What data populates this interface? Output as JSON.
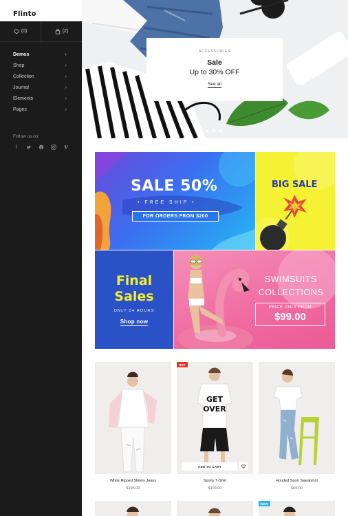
{
  "brand": {
    "logo": "Flinto"
  },
  "sidebar": {
    "wishlist_count": "(0)",
    "cart_count": "(2)",
    "nav": [
      {
        "label": "Demos"
      },
      {
        "label": "Shop"
      },
      {
        "label": "Collection"
      },
      {
        "label": "Journal"
      },
      {
        "label": "Elements"
      },
      {
        "label": "Pages"
      }
    ],
    "follow_label": "Follow us on:",
    "social_icons": [
      "facebook-icon",
      "twitter-icon",
      "pinterest-icon",
      "instagram-icon",
      "vimeo-icon"
    ]
  },
  "hero": {
    "eyebrow": "ACCESSORIES",
    "title": "Sale",
    "subtitle": "Up to 30% OFF",
    "link": "See all",
    "slides_total": 3,
    "active_slide": 1
  },
  "banners": {
    "sale": {
      "headline": "SALE 50%",
      "sub": "• FREE SHIP •",
      "pill": "FOR ORDERS FROM $200"
    },
    "big_sale": {
      "headline": "BIG SALE"
    },
    "final": {
      "line1": "Final",
      "line2": "Sales",
      "hours": "ONLY 24 HOURS",
      "cta": "Shop now"
    },
    "swim": {
      "line1": "SWIMSUITS",
      "line2": "COLLECTIONS",
      "price_label": "PRICE ONLY FROM",
      "price": "$99.00"
    }
  },
  "products": [
    {
      "name": "White Ripped Skinny Jeans",
      "price": "$195.00",
      "badge": ""
    },
    {
      "name": "Sporty T-Shirt",
      "price": "$109.00",
      "badge": "HOT",
      "add_to_cart": "ADD TO CART"
    },
    {
      "name": "Hooded Sport Sweatshirt",
      "price": "$69.00",
      "badge": ""
    }
  ],
  "second_row_badge": "NEW",
  "colors": {
    "sidebar_bg": "#1b1b1b",
    "hot": "#e8322c",
    "new": "#2bb6f0",
    "yellow": "#f4ef2e"
  }
}
